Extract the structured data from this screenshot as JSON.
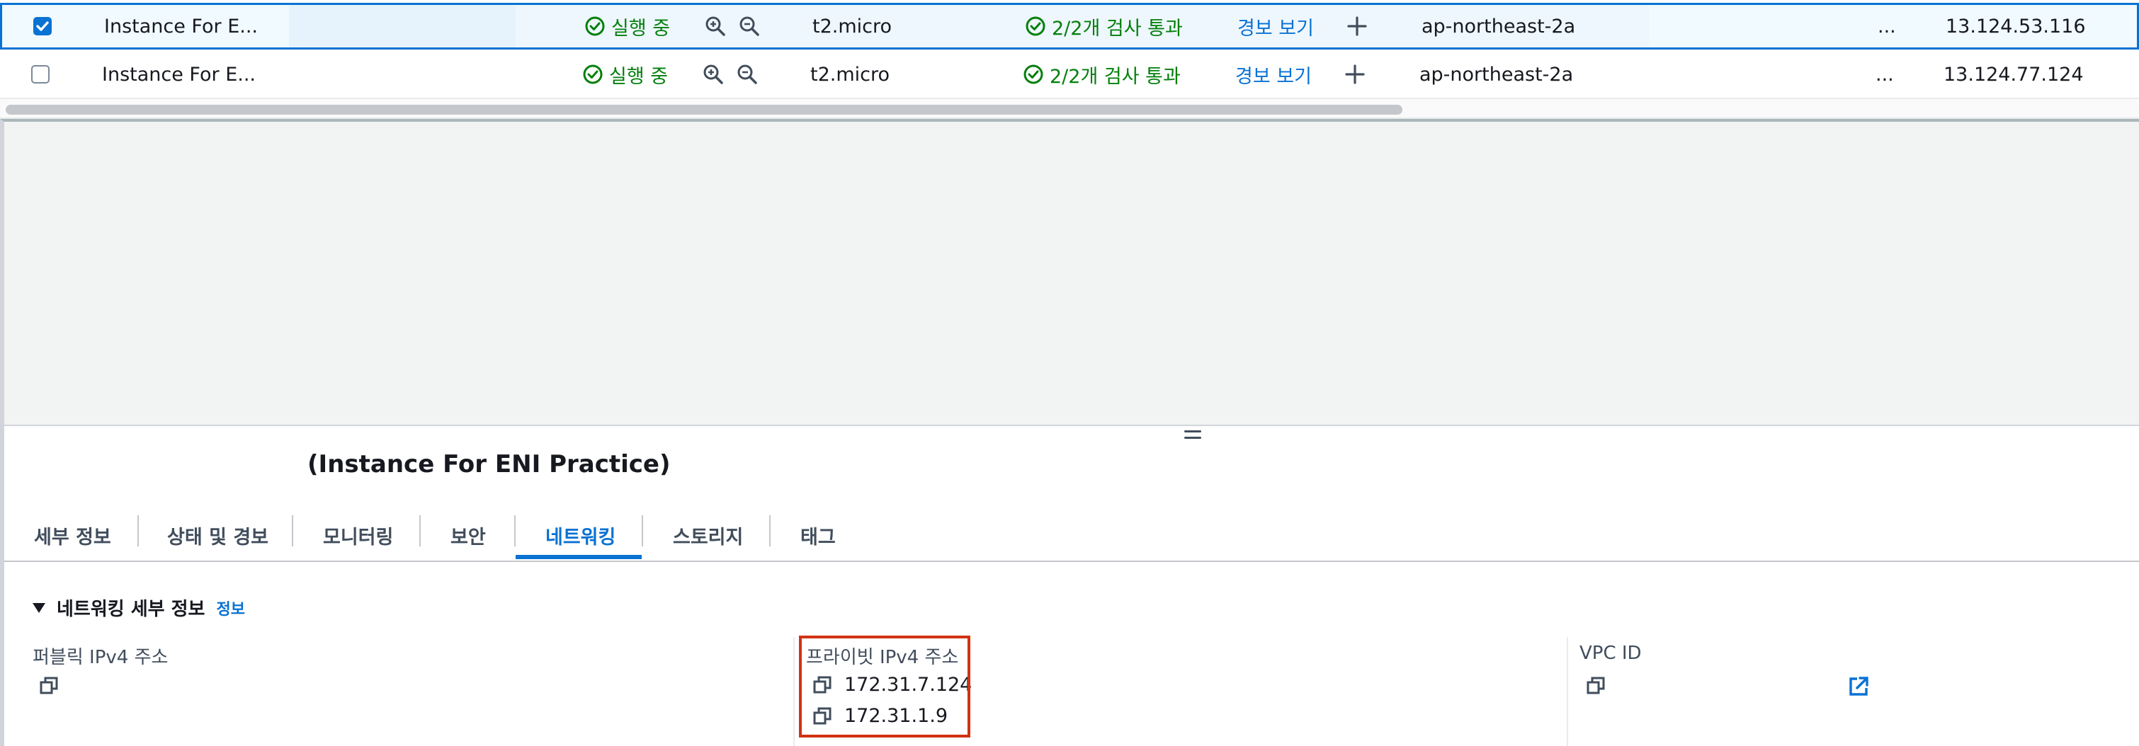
{
  "instances": [
    {
      "selected": true,
      "name": "Instance For E...",
      "state": "실행 중",
      "instance_type": "t2.micro",
      "status_check": "2/2개 검사 통과",
      "alarm_link": "경보 보기",
      "az": "ap-northeast-2a",
      "ellipsis": "...",
      "public_ip": "13.124.53.116"
    },
    {
      "selected": false,
      "name": "Instance For E...",
      "state": "실행 중",
      "instance_type": "t2.micro",
      "status_check": "2/2개 검사 통과",
      "alarm_link": "경보 보기",
      "az": "ap-northeast-2a",
      "ellipsis": "...",
      "public_ip": "13.124.77.124"
    }
  ],
  "details": {
    "title": "(Instance For ENI Practice)",
    "tabs": [
      {
        "label": "세부 정보",
        "active": false
      },
      {
        "label": "상태 및 경보",
        "active": false
      },
      {
        "label": "모니터링",
        "active": false
      },
      {
        "label": "보안",
        "active": false
      },
      {
        "label": "네트워킹",
        "active": true
      },
      {
        "label": "스토리지",
        "active": false
      },
      {
        "label": "태그",
        "active": false
      }
    ],
    "section_title": "네트워킹 세부 정보",
    "section_info": "정보",
    "public_ipv4_label": "퍼블릭 IPv4 주소",
    "private_ipv4_label": "프라이빗 IPv4 주소",
    "private_ipv4_values": [
      "172.31.7.124",
      "172.31.1.9"
    ],
    "vpc_id_label": "VPC ID"
  },
  "colors": {
    "accent": "#0972d3",
    "success": "#037f0c",
    "highlight_box": "#d13212"
  }
}
